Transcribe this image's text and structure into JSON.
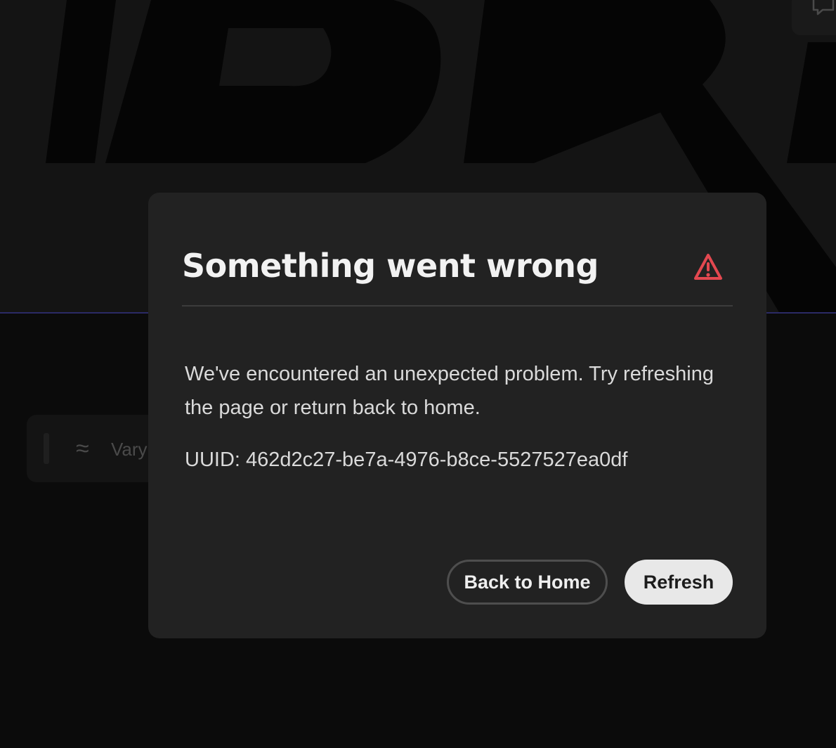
{
  "background": {
    "prompt_label": "Vary",
    "prompt_icon": "≈",
    "feedback_icon": "feedback-icon"
  },
  "dialog": {
    "title": "Something went wrong",
    "icon": "alert-icon",
    "message": "We've encountered an unexpected problem. Try refreshing the page or return back to home.",
    "uuid": "UUID: 462d2c27-be7a-4976-b8ce-5527527ea0df",
    "back_button_label": "Back to Home",
    "refresh_button_label": "Refresh"
  },
  "colors": {
    "alert": "#e34850",
    "dialog_bg": "#222222",
    "primary_button_bg": "#e8e8e8"
  }
}
